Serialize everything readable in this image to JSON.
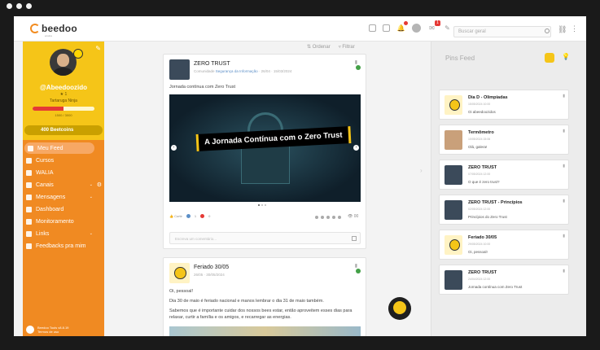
{
  "topbar": {
    "logo_text": "beedoo",
    "logo_sub": "ensina",
    "search_placeholder": "Buscar geral",
    "notif_count": "1"
  },
  "profile": {
    "username": "@Abeedoozido",
    "stars": "★ 1",
    "tagline": "Tartaruga Ninja",
    "xp_label": "1500 / 3000",
    "xp_fraction": 0.5,
    "coins": "400 Beetcoins"
  },
  "nav": {
    "items": [
      {
        "label": "Meu Feed"
      },
      {
        "label": "Cursos"
      },
      {
        "label": "WALIA"
      },
      {
        "label": "Canais"
      },
      {
        "label": "Mensagens"
      },
      {
        "label": "Dashboard"
      },
      {
        "label": "Monitoramento"
      },
      {
        "label": "Links"
      },
      {
        "label": "Feedbacks pra mim"
      }
    ],
    "footer_line1": "Beedoo Tools v8.8.19",
    "footer_line2": "Termos de uso"
  },
  "feed": {
    "order_label": "Ordenar",
    "filter_label": "Filtrar"
  },
  "post1": {
    "title": "ZERO TRUST",
    "meta_prefix": "Comunidade",
    "meta_channel": "Segurança da Informação",
    "meta_suffix": "· 26/04 · 15/03/2024",
    "text": "Jornada contínua com Zero Trust",
    "banner": "A Jornada Contínua com o Zero Trust",
    "react_label": "Curtir",
    "react_count1": "1",
    "react_count2": "0",
    "views": "00",
    "comment_placeholder": "Escreva um comentário..."
  },
  "post2": {
    "title": "Feriado 30/05",
    "meta": "26/05 · 30/05/2024",
    "line1": "Oi, pessoal!",
    "line2": "Dia 30 de maio é feriado nacional e manos lembrar o dia 31 de maio também.",
    "line3": "Sabemos que é importante cuidar dos nossos bees estar, então aproveitem esses dias para",
    "line4": "relaxar, curtir a família e os amigos, e recarregar as energias."
  },
  "pins": {
    "title": "Pins Feed",
    "cards": [
      {
        "title": "Dia D - Olimpíadas",
        "date": "15/05/2024 10:00",
        "sub": "Oi abeedoozidos"
      },
      {
        "title": "Termômetro",
        "date": "10/05/2024 15:06",
        "sub": "Olá, galera!"
      },
      {
        "title": "ZERO TRUST",
        "date": "07/05/2024 12:00",
        "sub": "O que é zero trust?"
      },
      {
        "title": "ZERO TRUST - Princípios",
        "date": "02/05/2024 12:00",
        "sub": "Princípios do Zero Trust"
      },
      {
        "title": "Feriado 30/05",
        "date": "29/05/2024 10:00",
        "sub": "Oi, pessoal!"
      },
      {
        "title": "ZERO TRUST",
        "date": "24/04/2024 12:00",
        "sub": "Jornada contínua com Zero Trust"
      }
    ]
  },
  "colors": {
    "brand_yellow": "#f5c518",
    "brand_orange": "#f08a22",
    "alert_red": "#e53935",
    "ok_green": "#43a047"
  }
}
